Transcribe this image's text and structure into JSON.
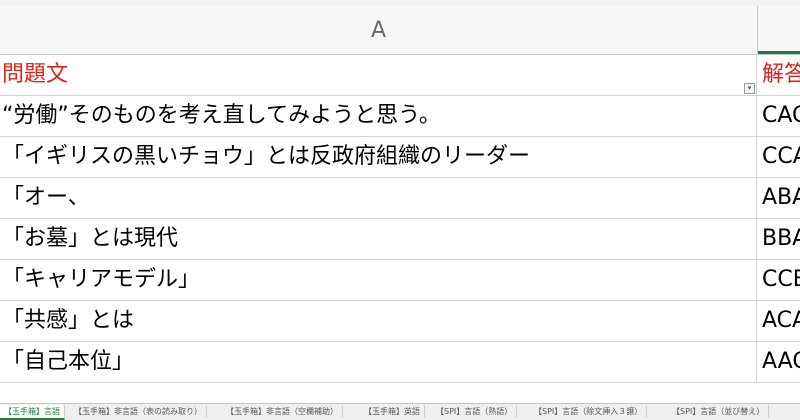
{
  "column_header": {
    "a": "A"
  },
  "header_row": {
    "a": "問題文",
    "b": "解答"
  },
  "rows": [
    {
      "a": "“労働”そのものを考え直してみようと思う。",
      "b": "CAC"
    },
    {
      "a": "「イギリスの黒いチョウ」とは反政府組織のリーダー",
      "b": "CCA"
    },
    {
      "a": "「オー、",
      "b": "ABA"
    },
    {
      "a": "「お墓」とは現代",
      "b": "BBA"
    },
    {
      "a": "「キャリアモデル」",
      "b": "CCB"
    },
    {
      "a": "「共感」とは",
      "b": "ACA"
    },
    {
      "a": "「自己本位」",
      "b": "AAC"
    }
  ],
  "sheet_tabs": [
    "【玉手箱】言語",
    "【玉手箱】非言語（表の読み取り）",
    "【玉手箱】非言語（空欄補助）",
    "【玉手箱】英語",
    "【SPI】言語（熟語）",
    "【SPI】言語（除文挿入３譲）",
    "【SPI】言語（並び替え）"
  ],
  "colors": {
    "header_text": "#e0201c",
    "accent": "#1d7a44"
  }
}
